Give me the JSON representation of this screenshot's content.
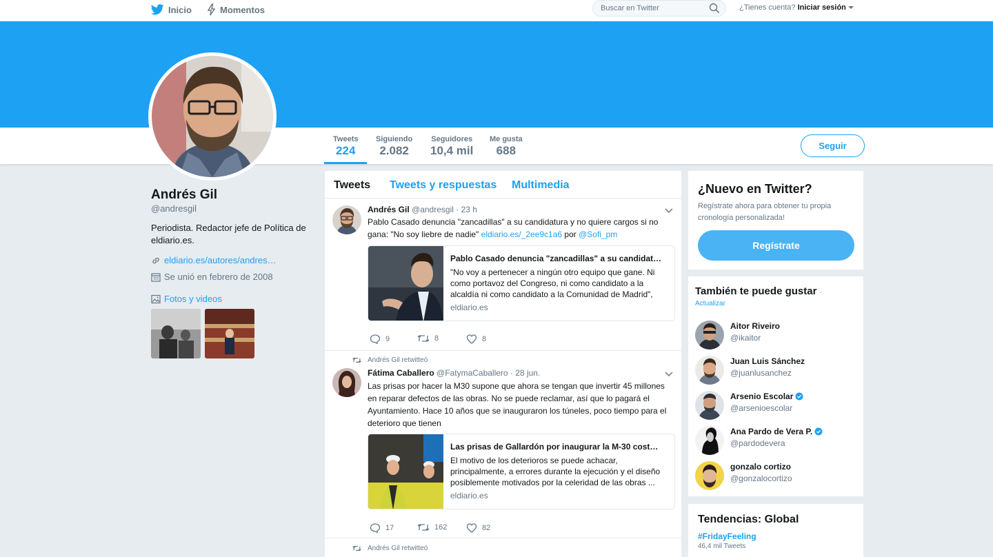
{
  "topnav": {
    "home_label": "Inicio",
    "moments_label": "Momentos",
    "search_placeholder": "Buscar en Twitter",
    "account_question": "¿Tienes cuenta?",
    "login_label": "Iniciar sesión"
  },
  "profile": {
    "name": "Andrés Gil",
    "handle": "@andresgil",
    "bio": "Periodista. Redactor jefe de Política de eldiario.es.",
    "url": "eldiario.es/autores/andres…",
    "joined": "Se unió en febrero de 2008",
    "photos_label": "Fotos y videos"
  },
  "stats": [
    {
      "label": "Tweets",
      "value": "224"
    },
    {
      "label": "Siguiendo",
      "value": "2.082"
    },
    {
      "label": "Seguidores",
      "value": "10,4 mil"
    },
    {
      "label": "Me gusta",
      "value": "688"
    }
  ],
  "follow_label": "Seguir",
  "timeline": {
    "tabs": [
      "Tweets",
      "Tweets y respuestas",
      "Multimedia"
    ],
    "tweets": [
      {
        "name": "Andrés Gil",
        "handle": "@andresgil",
        "time": "· 23 h",
        "text": "Pablo Casado denuncia \"zancadillas\" a su candidatura y no quiere cargos si no gana: \"No soy liebre de nadie\"",
        "link": "eldiario.es/_2ee9c1a6",
        "via": "por",
        "mention": "@Sofi_pm",
        "card_title": "Pablo Casado denuncia \"zancadillas\" a su candidat…",
        "card_desc": "\"No voy a pertenecer a ningún otro equipo que gane. Ni como portavoz del Congreso, ni como candidato a la alcaldía ni como candidato a la Comunidad de Madrid\",",
        "card_domain": "eldiario.es",
        "replies": "9",
        "retweets": "8",
        "likes": "8"
      },
      {
        "retweet_context": "Andrés Gil retwitteó",
        "name": "Fátima Caballero",
        "handle": "@FatymaCaballero",
        "time": "· 28 jun.",
        "text": "Las prisas por hacer la M30 supone que ahora se tengan que invertir 45 millones en reparar defectos de las obras. No se puede reclamar, así que lo pagará el Ayuntamiento. Hace 10 años que se inauguraron los túneles, poco tiempo para el deterioro que tienen",
        "card_title": "Las prisas de Gallardón por inaugurar la M-30 cost…",
        "card_desc": "El motivo de los deterioros se puede achacar, principalmente, a errores durante la ejecución y el diseño posiblemente motivados por la celeridad de las obras ...",
        "card_domain": "eldiario.es",
        "replies": "17",
        "retweets": "162",
        "likes": "82"
      },
      {
        "retweet_context": "Andrés Gil retwitteó"
      }
    ]
  },
  "signup": {
    "title": "¿Nuevo en Twitter?",
    "subtitle": "Regístrate ahora para obtener tu propia cronología personalizada!",
    "button": "Regístrate"
  },
  "who_to_follow": {
    "title": "También te puede gustar",
    "dot": "·",
    "refresh": "Actualizar",
    "users": [
      {
        "name": "Aitor Riveiro",
        "handle": "@ikaitor",
        "verified": false
      },
      {
        "name": "Juan Luis Sánchez",
        "handle": "@juanlusanchez",
        "verified": false
      },
      {
        "name": "Arsenio Escolar",
        "handle": "@arsenioescolar",
        "verified": true
      },
      {
        "name": "Ana Pardo de Vera P.",
        "handle": "@pardodevera",
        "verified": true
      },
      {
        "name": "gonzalo cortizo",
        "handle": "@gonzalocortizo",
        "verified": false
      }
    ]
  },
  "trends": {
    "title": "Tendencias: Global",
    "items": [
      {
        "name": "#FridayFeeling",
        "count": "46,4 mil Tweets"
      }
    ]
  },
  "colors": {
    "accent": "#1da1f2",
    "background": "#e6ecf0"
  }
}
